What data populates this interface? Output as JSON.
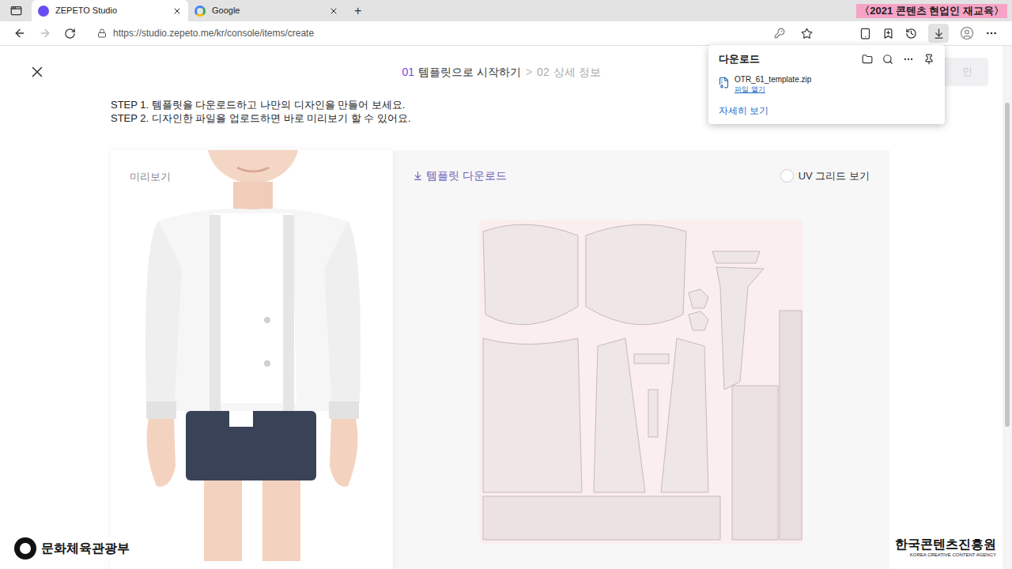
{
  "browser": {
    "tabs": [
      {
        "label": "ZEPETO Studio",
        "selected": true
      },
      {
        "label": "Google",
        "selected": false
      }
    ],
    "new_tab": "+",
    "badge": "〈2021 콘텐츠 현업인 재교육〉",
    "url": "https://studio.zepeto.me/kr/console/items/create",
    "downloads_open": true
  },
  "downloads": {
    "title": "다운로드",
    "files": [
      {
        "name": "OTR_61_template.zip",
        "action": "파일 열기"
      }
    ],
    "more": "자세히 보기"
  },
  "page": {
    "steps": [
      {
        "number": "01",
        "label": "템플릿으로 시작하기",
        "selected": true
      },
      {
        "number": "02",
        "label": "상세 정보",
        "selected": false
      }
    ],
    "separator": ">",
    "confirm_button": "인",
    "instructions": [
      "STEP 1. 템플릿을 다운로드하고 나만의 디자인을 만들어 보세요.",
      "STEP 2. 디자인한 파일을 업로드하면 바로 미리보기 할 수 있어요."
    ],
    "preview": {
      "label": "미리보기"
    },
    "template": {
      "download": "템플릿 다운로드",
      "uv_grid": {
        "label": "UV 그리드 보기",
        "checked": false
      }
    }
  },
  "footer": {
    "ministry": "문화체육관광부",
    "agency": "한국콘텐츠진흥원",
    "agency_en": "KOREA CREATIVE CONTENT AGENCY"
  }
}
